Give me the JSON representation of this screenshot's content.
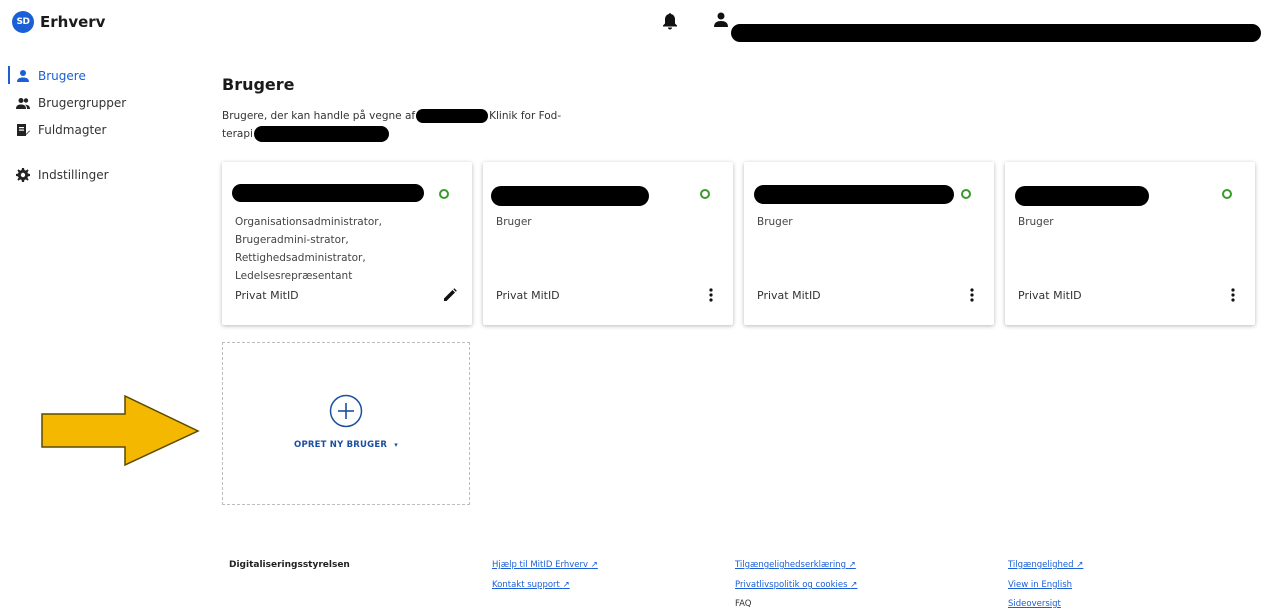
{
  "header": {
    "logo_badge": "SD",
    "app_name": "Erhverv"
  },
  "sidebar": {
    "items": [
      {
        "label": "Brugere",
        "icon": "person-icon",
        "active": true
      },
      {
        "label": "Brugergrupper",
        "icon": "people-icon",
        "active": false
      },
      {
        "label": "Fuldmagter",
        "icon": "document-edit-icon",
        "active": false
      },
      {
        "label": "Indstillinger",
        "icon": "gear-icon",
        "active": false
      }
    ]
  },
  "main": {
    "title": "Brugere",
    "description_part1": "Brugere, der kan handle på vegne af",
    "description_part2": "Klinik for Fod-",
    "description_part3": "terapi"
  },
  "cards": [
    {
      "role": "Organisationsadministrator, Brugeradmini-strator, Rettighedsadministrator, Ledelsesrepræsentant",
      "login": "Privat MitID",
      "action_icon": "pencil-icon"
    },
    {
      "role": "Bruger",
      "login": "Privat MitID",
      "action_icon": "more-vertical-icon"
    },
    {
      "role": "Bruger",
      "login": "Privat MitID",
      "action_icon": "more-vertical-icon"
    },
    {
      "role": "Bruger",
      "login": "Privat MitID",
      "action_icon": "more-vertical-icon"
    }
  ],
  "new_user": {
    "label": "OPRET NY BRUGER",
    "icon": "plus-circle-icon"
  },
  "footer": {
    "org": "Digitaliseringsstyrelsen",
    "col2": [
      "Hjælp til MitID Erhverv",
      "Kontakt support"
    ],
    "col3": [
      "Tilgængelighedserklæring",
      "Privatlivspolitik og cookies",
      "FAQ"
    ],
    "col4": [
      "Tilgængelighed",
      "View in English",
      "Sideoversigt"
    ]
  },
  "colors": {
    "accent": "#1b5fd6",
    "status_active": "#3a9a2c",
    "arrow_fill": "#f5b800"
  }
}
